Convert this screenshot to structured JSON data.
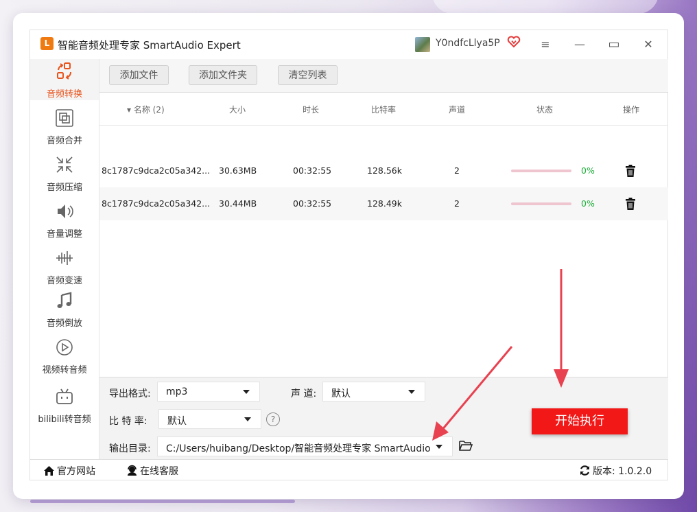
{
  "app": {
    "logo_glyph": "L",
    "title": "智能音频处理专家 SmartAudio Expert",
    "username": "Y0ndfcLlya5P"
  },
  "window_controls": {
    "menu": "≡",
    "minimize": "—",
    "maximize": "▭",
    "close": "✕"
  },
  "sidebar": {
    "items": [
      {
        "label": "音频转换",
        "icon": "audio-convert-icon",
        "active": true
      },
      {
        "label": "音频合并",
        "icon": "merge-icon"
      },
      {
        "label": "音频压缩",
        "icon": "compress-icon"
      },
      {
        "label": "音量调整",
        "icon": "volume-icon"
      },
      {
        "label": "音频变速",
        "icon": "speed-icon"
      },
      {
        "label": "音频倒放",
        "icon": "music-note-icon"
      },
      {
        "label": "视频转音频",
        "icon": "play-circle-icon"
      },
      {
        "label": "bilibili转音频",
        "icon": "bilibili-icon"
      }
    ]
  },
  "toolbar": {
    "add_file": "添加文件",
    "add_folder": "添加文件夹",
    "clear_list": "清空列表"
  },
  "table": {
    "headers": {
      "name": "▾ 名称 (2)",
      "size": "大小",
      "duration": "时长",
      "bitrate": "比特率",
      "channels": "声道",
      "status": "状态",
      "action": "操作"
    },
    "rows": [
      {
        "name": "8c1787c9dca2c05a342...",
        "size": "30.63MB",
        "duration": "00:32:55",
        "bitrate": "128.56k",
        "channels": "2",
        "progress": 0,
        "percent": "0%"
      },
      {
        "name": "8c1787c9dca2c05a342...",
        "size": "30.44MB",
        "duration": "00:32:55",
        "bitrate": "128.49k",
        "channels": "2",
        "progress": 0,
        "percent": "0%"
      }
    ]
  },
  "settings": {
    "format_label": "导出格式:",
    "format_value": "mp3",
    "channel_label": "声 道:",
    "channel_value": "默认",
    "bitrate_label": "比 特 率:",
    "bitrate_value": "默认",
    "help_glyph": "?",
    "output_label": "输出目录:",
    "output_value": "C:/Users/huibang/Desktop/智能音频处理专家 SmartAudio",
    "start_button": "开始执行"
  },
  "statusbar": {
    "website": "官方网站",
    "support": "在线客服",
    "version": "版本:  1.0.2.0"
  },
  "colors": {
    "accent_orange": "#e8531c",
    "start_red": "#f21818",
    "progress_green": "#1fae3b",
    "annotation_arrow": "#e8414f"
  }
}
